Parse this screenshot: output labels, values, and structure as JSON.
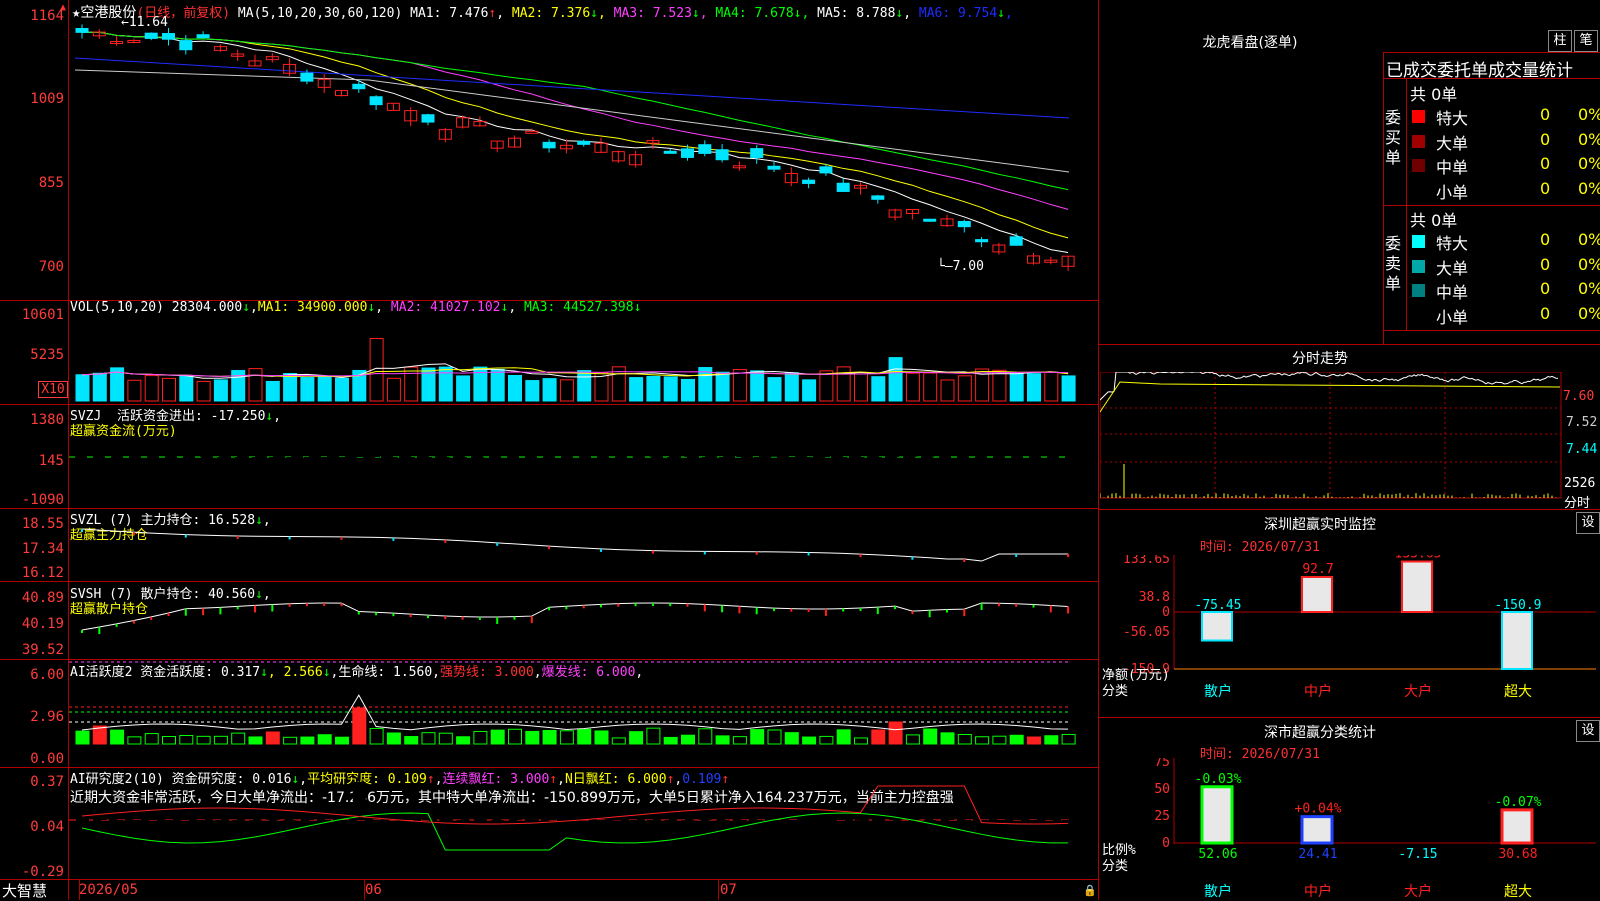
{
  "stock": {
    "title": "★空港股份",
    "period": "(日线，前复权)",
    "ma_label": "MA(5,10,20,30,60,120)"
  },
  "colors": {
    "bg": "#000000",
    "frame": "#b00000",
    "up": "#ff2020",
    "down": "#00e5ff",
    "green": "#00ff00",
    "yellow": "#ffff00",
    "magenta": "#ff40ff",
    "blue": "#1e2cff",
    "white": "#ffffff"
  },
  "main_ma": [
    {
      "label": "MA1: 7.476",
      "arrow": "↑",
      "color": "#ffffff",
      "arrow_color": "#ff3030"
    },
    {
      "label": "MA2: 7.376",
      "arrow": "↓",
      "color": "#ffff00",
      "arrow_color": "#00ff00"
    },
    {
      "label": "MA3: 7.523",
      "arrow": "↓",
      "color": "#ff40ff",
      "arrow_color": "#00ff00"
    },
    {
      "label": "MA4: 7.678",
      "arrow": "↓",
      "color": "#00ff00",
      "arrow_color": "#00ff00"
    },
    {
      "label": "MA5: 8.788",
      "arrow": "↓",
      "color": "#ffffff",
      "arrow_color": "#00ff00"
    },
    {
      "label": "MA6: 9.754",
      "arrow": "↓",
      "color": "#1e2cff",
      "arrow_color": "#00ff00"
    }
  ],
  "main_y": [
    "1164",
    "1009",
    "855",
    "700"
  ],
  "main_hi": "11.64",
  "main_lo": "7.00",
  "vol": {
    "title": "VOL(5,10,20)",
    "value": "28304.000",
    "arrow": "↓",
    "ma1": "MA1: 34900.000",
    "ma2": "MA2: 41027.102",
    "ma3": "MA3: 44527.398",
    "y": [
      "10601",
      "5235"
    ],
    "unit": "X10"
  },
  "svzj": {
    "title": "SVZJ",
    "name": "活跃资金进出: -17.250",
    "arrow": "↓",
    "sub": "超赢资金流(万元)",
    "y": [
      "1380",
      "145",
      "-1090"
    ]
  },
  "svzl": {
    "title": "SVZL (7) 主力持仓: 16.528",
    "arrow": "↓",
    "comma": ",",
    "sub": "超赢主力持仓",
    "y": [
      "18.55",
      "17.34",
      "16.12"
    ]
  },
  "svsh": {
    "title": "SVSH (7) 散户持仓: 40.560",
    "arrow": "↓",
    "comma": ",",
    "sub": "超赢散户持仓",
    "y": [
      "40.89",
      "40.19",
      "39.52"
    ]
  },
  "ai1": {
    "title": "AI活跃度2 资金活跃度: 0.317",
    "a1": "↓",
    "v2": ", 2.566",
    "comma": ",",
    "life": "生命线: 1.560",
    "strong": "强势线: 3.000",
    "burst": "爆发线: 6.000",
    "y": [
      "6.00",
      "2.96",
      "0.00"
    ]
  },
  "ai2": {
    "title": "AI研究度2(10) 资金研究度: 0.016",
    "a1": "↓",
    "avg": "平均研究度: 0.109",
    "a2": "↑",
    "cont": "连续飘红: 3.000",
    "a3": "↑",
    "nday": "N日飘红: 6.000",
    "a4": "↑",
    "v5": "0.109",
    "a5": "↑",
    "comma": ",",
    "y": [
      "0.37",
      "0.04",
      "-0.29"
    ],
    "note": "近期大资金非常活跃，今日大单净流出：-17.246万元，其中特大单净流出：-150.899万元，大单5日累计净入164.237万元，当前主力控盘强"
  },
  "bottom": {
    "brand": "大智慧",
    "dates": [
      "2026/05",
      "06",
      "07"
    ]
  },
  "dragon": {
    "title": "龙虎看盘(逐单)",
    "tab1": "柱",
    "tab2": "笔",
    "header": "已成交委托单成交量统计",
    "buy_label": [
      "委",
      "买",
      "单"
    ],
    "sell_label": [
      "委",
      "卖",
      "单"
    ],
    "buy_total": "共 0单",
    "sell_total": "共 0单",
    "buy_rows": [
      {
        "name": "特大",
        "n": "0",
        "p": "0%",
        "color": "#ff0000"
      },
      {
        "name": "大单",
        "n": "0",
        "p": "0%",
        "color": "#a00000"
      },
      {
        "name": "中单",
        "n": "0",
        "p": "0%",
        "color": "#700000"
      },
      {
        "name": "小单",
        "n": "0",
        "p": "0%",
        "color": ""
      }
    ],
    "sell_rows": [
      {
        "name": "特大",
        "n": "0",
        "p": "0%",
        "color": "#00ffff"
      },
      {
        "name": "大单",
        "n": "0",
        "p": "0%",
        "color": "#00a8a8"
      },
      {
        "name": "中单",
        "n": "0",
        "p": "0%",
        "color": "#008080"
      },
      {
        "name": "小单",
        "n": "0",
        "p": "0%",
        "color": ""
      }
    ]
  },
  "intraday": {
    "title": "分时走势",
    "y": [
      "7.60",
      "7.52",
      "7.44"
    ],
    "vol": "2526",
    "vol_unit": "分时"
  },
  "sz_monitor": {
    "title": "深圳超赢实时监控",
    "btn": "设",
    "time": "时间: 2026/07/31",
    "y": [
      "133.65",
      "38.8",
      "0",
      "-56.05",
      "-150.9"
    ],
    "ylabel": "净额(万元)",
    "xlabel": "分类",
    "cats": [
      "散户",
      "中户",
      "大户",
      "超大"
    ],
    "values": [
      -75.45,
      92.7,
      133.65,
      -150.9
    ],
    "labels": [
      "-75.45",
      "92.7",
      "133.65",
      "-150.9"
    ]
  },
  "sz_class": {
    "title": "深市超赢分类统计",
    "btn": "设",
    "time": "时间: 2026/07/31",
    "y": [
      "75",
      "50",
      "25",
      "0"
    ],
    "ylabel": "比例%",
    "xlabel": "分类",
    "cats": [
      "散户",
      "中户",
      "大户",
      "超大"
    ],
    "values": [
      52.06,
      24.41,
      -7.15,
      30.68
    ],
    "labels": [
      "52.06",
      "24.41",
      "-7.15",
      "30.68"
    ],
    "changes": [
      "-0.03%",
      "+0.04%",
      "",
      "-0.07%"
    ]
  },
  "chart_data": [
    {
      "type": "bar",
      "title": "深圳超赢实时监控",
      "categories": [
        "散户",
        "中户",
        "大户",
        "超大"
      ],
      "values": [
        -75.45,
        92.7,
        133.65,
        -150.9
      ],
      "ylabel": "净额(万元)",
      "xlabel": "分类",
      "ylim": [
        -150.9,
        133.65
      ]
    },
    {
      "type": "bar",
      "title": "深市超赢分类统计",
      "categories": [
        "散户",
        "中户",
        "大户",
        "超大"
      ],
      "values": [
        52.06,
        24.41,
        -7.15,
        30.68
      ],
      "ylabel": "比例%",
      "xlabel": "分类",
      "ylim": [
        0,
        75
      ]
    }
  ]
}
